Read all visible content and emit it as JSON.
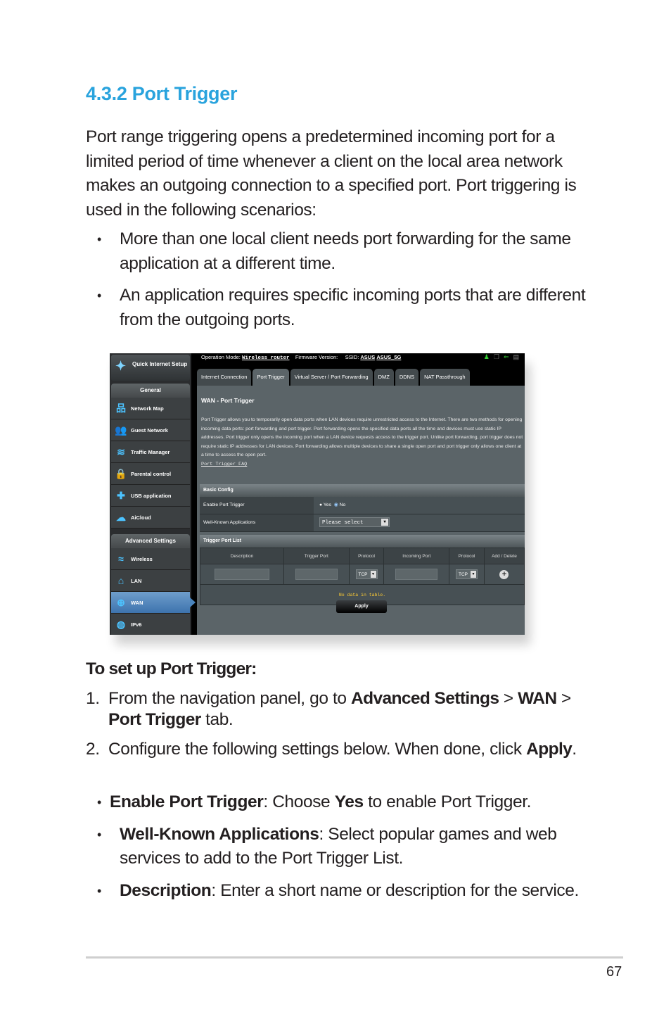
{
  "heading": "4.3.2 Port Trigger",
  "intro": "Port range triggering opens a predetermined incoming port for a limited period of time whenever a client on the local area network makes an outgoing connection to a specified port. Port triggering is used in the following scenarios:",
  "scenarios": [
    "More than one local client needs port forwarding for the same application at a different time.",
    "An application requires specific incoming ports that are different from the outgoing ports."
  ],
  "router_ui": {
    "quick_setup": "Quick Internet Setup",
    "general_label": "General",
    "general_items": [
      {
        "icon": "network-map-icon",
        "glyph": "品",
        "label": "Network Map"
      },
      {
        "icon": "guest-network-icon",
        "glyph": "👥",
        "label": "Guest Network"
      },
      {
        "icon": "traffic-manager-icon",
        "glyph": "≋",
        "label": "Traffic Manager"
      },
      {
        "icon": "parental-control-icon",
        "glyph": "🔒",
        "label": "Parental control"
      },
      {
        "icon": "usb-application-icon",
        "glyph": "✚",
        "label": "USB application"
      },
      {
        "icon": "aicloud-icon",
        "glyph": "☁",
        "label": "AiCloud"
      }
    ],
    "advanced_label": "Advanced Settings",
    "advanced_items": [
      {
        "icon": "wireless-icon",
        "glyph": "≈",
        "label": "Wireless"
      },
      {
        "icon": "lan-icon",
        "glyph": "⌂",
        "label": "LAN"
      },
      {
        "icon": "wan-icon",
        "glyph": "⊕",
        "label": "WAN"
      },
      {
        "icon": "ipv6-icon",
        "glyph": "◍",
        "label": "IPv6"
      }
    ],
    "operation_mode_label": "Operation Mode:",
    "operation_mode_value": "Wireless router",
    "firmware_label": "Firmware Version:",
    "ssid_label": "SSID:",
    "ssid_1": "ASUS",
    "ssid_2": "ASUS_5G",
    "tabs": [
      "Internet Connection",
      "Port Trigger",
      "Virtual Server / Port Forwarding",
      "DMZ",
      "DDNS",
      "NAT Passthrough"
    ],
    "page_title": "WAN - Port Trigger",
    "description": "Port Trigger allows you to temporarily open data ports when LAN devices require unrestricted access to the Internet. There are two methods for opening incoming data ports: port forwarding and port trigger. Port forwarding opens the specified data ports all the time and devices must use static IP addresses. Port trigger only opens the incoming port when a LAN device requests access to the trigger port. Unlike port forwarding, port trigger does not require static IP addresses for LAN devices. Port forwarding allows multiple devices to share a single open port and port trigger only allows one client at a time to access the open port.",
    "faq_link": "Port Trigger FAQ",
    "basic_config": "Basic Config",
    "enable_label": "Enable Port Trigger",
    "yes": "Yes",
    "no": "No",
    "enable_value": "No",
    "apps_label": "Well-Known Applications",
    "apps_value": "Please select",
    "trigger_list": "Trigger Port List",
    "columns": [
      "Description",
      "Trigger Port",
      "Protocol",
      "Incoming Port",
      "Protocol",
      "Add / Delete"
    ],
    "trigger_protocol": "TCP",
    "incoming_protocol": "TCP",
    "no_data": "No data in table.",
    "apply": "Apply"
  },
  "setup_heading": "To set up Port Trigger:",
  "steps": [
    {
      "n": "1.",
      "a": "From the navigation panel, go to ",
      "b1": "Advanced Settings",
      "c": " > ",
      "b2": "WAN",
      "d": " > ",
      "b3": "Port Trigger",
      "e": " tab."
    },
    {
      "n": "2.",
      "a": "Configure the following settings below. When done, click ",
      "b1": "Apply",
      "c": "."
    }
  ],
  "settings": [
    {
      "term": "Enable Port Trigger",
      "text1": ": Choose ",
      "bold2": "Yes",
      "text2": " to enable Port Trigger."
    },
    {
      "term": "Well-Known Applications",
      "text1": ": Select popular games and web services to add to the Port Trigger List."
    },
    {
      "term": "Description",
      "text1": ": Enter a short name or description for the service."
    }
  ],
  "page_number": "67"
}
